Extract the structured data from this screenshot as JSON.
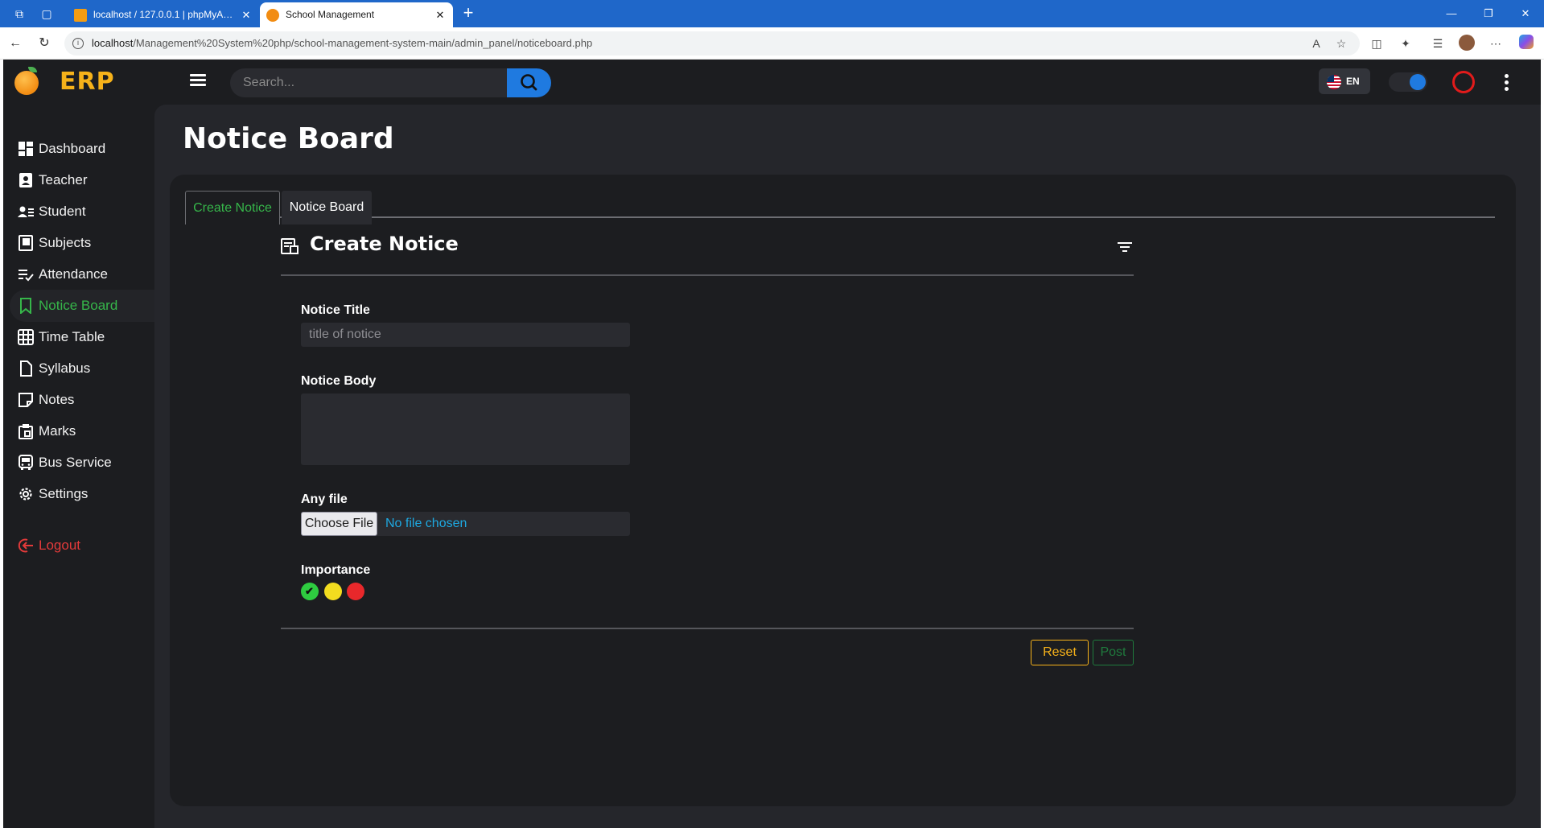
{
  "browser": {
    "tabs": [
      {
        "title": "localhost / 127.0.0.1 | phpMyAdmi",
        "active": false
      },
      {
        "title": "School Management",
        "active": true
      }
    ],
    "url_host": "localhost",
    "url_path": "/Management%20System%20php/school-management-system-main/admin_panel/noticeboard.php"
  },
  "app": {
    "logo_text": "ERP",
    "search_placeholder": "Search...",
    "language": "EN",
    "colors": {
      "accent": "#1f7ae0",
      "active": "#36b64a",
      "logo": "#f6b21a",
      "danger": "#e23a3a"
    }
  },
  "sidebar": {
    "items": [
      {
        "label": "Dashboard",
        "icon": "dashboard-icon"
      },
      {
        "label": "Teacher",
        "icon": "teacher-icon"
      },
      {
        "label": "Student",
        "icon": "student-icon"
      },
      {
        "label": "Subjects",
        "icon": "book-icon"
      },
      {
        "label": "Attendance",
        "icon": "attendance-icon"
      },
      {
        "label": "Notice Board",
        "icon": "bookmark-icon",
        "active": true
      },
      {
        "label": "Time Table",
        "icon": "table-icon"
      },
      {
        "label": "Syllabus",
        "icon": "document-icon"
      },
      {
        "label": "Notes",
        "icon": "note-icon"
      },
      {
        "label": "Marks",
        "icon": "marks-icon"
      },
      {
        "label": "Bus Service",
        "icon": "bus-icon"
      },
      {
        "label": "Settings",
        "icon": "gear-icon"
      }
    ],
    "logout": "Logout"
  },
  "main": {
    "title": "Notice Board",
    "tabs": [
      "Create Notice",
      "Notice Board"
    ],
    "form": {
      "heading": "Create Notice",
      "notice_title_label": "Notice Title",
      "notice_title_placeholder": "title of notice",
      "notice_body_label": "Notice Body",
      "file_label": "Any file",
      "choose_file": "Choose File",
      "no_file": "No file chosen",
      "importance_label": "Importance",
      "importance_levels": [
        "green",
        "yellow",
        "red"
      ],
      "selected_importance": "green",
      "reset": "Reset",
      "post": "Post"
    }
  }
}
